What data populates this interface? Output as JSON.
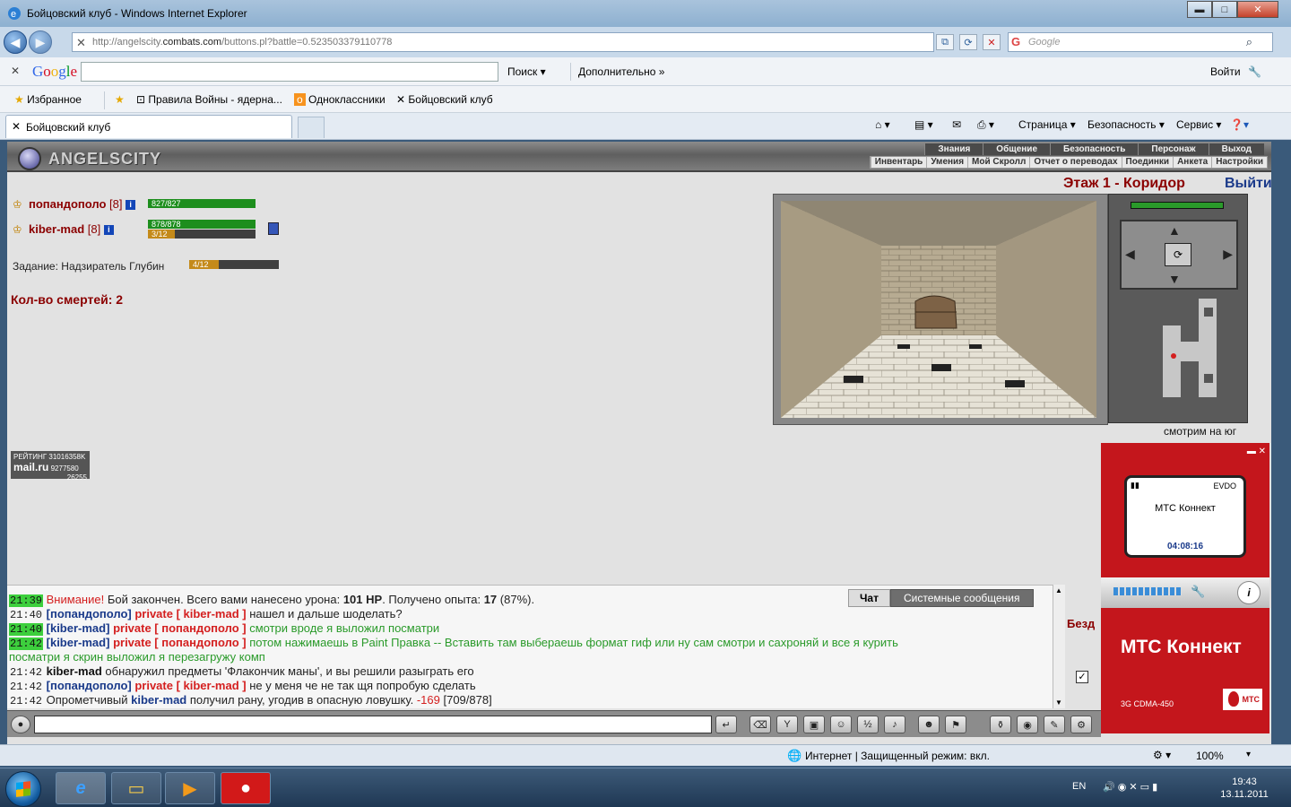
{
  "window": {
    "title": "Бойцовский клуб - Windows Internet Explorer",
    "min": "▬",
    "max": "□",
    "close": "✕"
  },
  "address": {
    "url_prefix": "http://angelscity.",
    "url_domain": "combats.com",
    "url_rest": "/buttons.pl?battle=0.523503379110778",
    "search_placeholder": "Google"
  },
  "google_toolbar": {
    "logo": "Google",
    "search_btn": "Поиск",
    "more_btn": "Дополнительно »",
    "signin_btn": "Войти"
  },
  "favorites_bar": {
    "favorites": "Избранное",
    "items": [
      "Правила Войны - ядерна...",
      "Одноклассники",
      "Бойцовский клуб"
    ]
  },
  "tabs": {
    "active": "Бойцовский клуб"
  },
  "command_bar": {
    "page": "Страница",
    "security": "Безопасность",
    "service": "Сервис"
  },
  "game": {
    "brand": "ANGELSCITY",
    "menu_top": [
      "Знания",
      "Общение",
      "Безопасность",
      "Персонаж",
      "Выход"
    ],
    "menu_bottom": [
      "Инвентарь",
      "Умения",
      "Мой Скролл",
      "Отчет о переводах",
      "Поединки",
      "Анкета",
      "Настройки"
    ],
    "players": [
      {
        "name": "попандополо",
        "level": "[8]",
        "hp": "827/827",
        "hp_fraction": 1.0
      },
      {
        "name": "kiber-mad",
        "level": "[8]",
        "hp": "878/878",
        "hp_fraction": 1.0,
        "quest": "3/12",
        "quest_fraction": 0.25
      }
    ],
    "task_label": "Задание:",
    "task_name": "Надзиратель Глубин",
    "task_progress": "4/12",
    "task_fraction": 0.33,
    "deaths": "Кол-во смертей: 2",
    "location": "Этаж 1 - Коридор",
    "exit": "Выйти",
    "facing": "смотрим на юг",
    "rating": {
      "label": "РЕЙТИНГ",
      "n1": "31016358K",
      "logo": "mail.ru",
      "n2": "9277580",
      "n3": "26255"
    }
  },
  "chat": {
    "tabs": [
      "Чат",
      "Системные сообщения"
    ],
    "lines": [
      {
        "ts": "21:39",
        "hl": true,
        "parts": [
          [
            "red",
            "Внимание! "
          ],
          [
            "",
            "Бой закончен. Всего вами нанесено урона: "
          ],
          [
            "b",
            "101 HP"
          ],
          [
            "",
            ". Получено опыта: "
          ],
          [
            "b",
            "17"
          ],
          [
            "",
            " (87%)."
          ]
        ]
      },
      {
        "ts": "21:40",
        "hl": false,
        "parts": [
          [
            "nick",
            "[попандополо]"
          ],
          [
            "",
            " "
          ],
          [
            "priv",
            "private [ kiber-mad ]"
          ],
          [
            "",
            " нашел и дальше шоделать?"
          ]
        ]
      },
      {
        "ts": "21:40",
        "hl": true,
        "parts": [
          [
            "nick",
            "[kiber-mad]"
          ],
          [
            "",
            " "
          ],
          [
            "priv",
            "private [ попандополо ]"
          ],
          [
            "green",
            " смотри вроде я выложил посматри"
          ]
        ]
      },
      {
        "ts": "21:42",
        "hl": true,
        "parts": [
          [
            "nick",
            "[kiber-mad]"
          ],
          [
            "",
            " "
          ],
          [
            "priv",
            "private [ попандополо ]"
          ],
          [
            "green",
            " потом нажимаешь в Paint Правка -- Вставить там выбераешь формат гиф или ну сам смотри и сахроняй и все я курить"
          ]
        ]
      },
      {
        "ts": "",
        "hl": false,
        "parts": [
          [
            "green",
            "посматри я скрин выложил я перезагружу комп"
          ]
        ]
      },
      {
        "ts": "21:42",
        "hl": false,
        "parts": [
          [
            "nickb",
            "kiber-mad"
          ],
          [
            "",
            " обнаружил предметы 'Флакончик маны', и вы решили разыграть его"
          ]
        ]
      },
      {
        "ts": "21:42",
        "hl": false,
        "parts": [
          [
            "nick",
            "[попандополо]"
          ],
          [
            "",
            " "
          ],
          [
            "priv",
            "private [ kiber-mad ]"
          ],
          [
            "",
            " не у меня че не так щя попробую сделать"
          ]
        ]
      },
      {
        "ts": "21:42",
        "hl": false,
        "parts": [
          [
            "",
            "Опрометчивый "
          ],
          [
            "nick",
            "kiber-mad"
          ],
          [
            "",
            " получил рану, угодив в опасную ловушку. "
          ],
          [
            "red",
            "-169"
          ],
          [
            "",
            " [709/878]"
          ]
        ]
      }
    ],
    "side_label": "Безд"
  },
  "ad": {
    "phone_net": "EVDO",
    "phone_name": "МТС Коннект",
    "phone_time": "04:08:16",
    "title": "МТС Коннект",
    "subtitle": "3G CDMA-450",
    "logo": "МТС"
  },
  "statusbar": {
    "zone": "Интернет | Защищенный режим: вкл.",
    "zoom": "100%"
  },
  "taskbar": {
    "lang": "EN",
    "time": "19:43",
    "date": "13.11.2011"
  }
}
